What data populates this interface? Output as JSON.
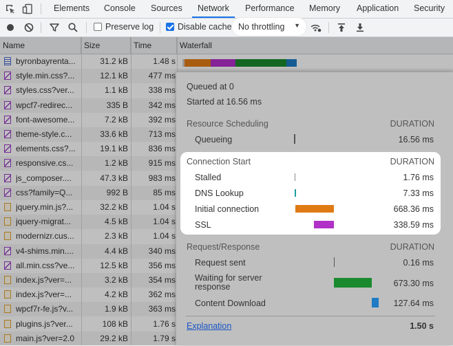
{
  "tabs": {
    "items": [
      "Elements",
      "Console",
      "Sources",
      "Network",
      "Performance",
      "Memory",
      "Application",
      "Security"
    ],
    "active": "Network"
  },
  "toolbar": {
    "preserve_log": "Preserve log",
    "preserve_log_checked": false,
    "disable_cache": "Disable cache",
    "disable_cache_checked": true,
    "throttling": "No throttling"
  },
  "columns": [
    "Name",
    "Size",
    "Time",
    "Waterfall"
  ],
  "rows": [
    {
      "name": "byronbayrenta...",
      "size": "31.2 kB",
      "time": "1.48 s",
      "type": "doc"
    },
    {
      "name": "style.min.css?...",
      "size": "12.1 kB",
      "time": "477 ms",
      "type": "css"
    },
    {
      "name": "styles.css?ver...",
      "size": "1.1 kB",
      "time": "338 ms",
      "type": "css"
    },
    {
      "name": "wpcf7-redirec...",
      "size": "335 B",
      "time": "342 ms",
      "type": "css"
    },
    {
      "name": "font-awesome...",
      "size": "7.2 kB",
      "time": "392 ms",
      "type": "css"
    },
    {
      "name": "theme-style.c...",
      "size": "33.6 kB",
      "time": "713 ms",
      "type": "css"
    },
    {
      "name": "elements.css?...",
      "size": "19.1 kB",
      "time": "836 ms",
      "type": "css"
    },
    {
      "name": "responsive.cs...",
      "size": "1.2 kB",
      "time": "915 ms",
      "type": "css"
    },
    {
      "name": "js_composer....",
      "size": "47.3 kB",
      "time": "983 ms",
      "type": "css"
    },
    {
      "name": "css?family=Q...",
      "size": "992 B",
      "time": "85 ms",
      "type": "css"
    },
    {
      "name": "jquery.min.js?...",
      "size": "32.2 kB",
      "time": "1.04 s",
      "type": "js"
    },
    {
      "name": "jquery-migrat...",
      "size": "4.5 kB",
      "time": "1.04 s",
      "type": "js"
    },
    {
      "name": "modernizr.cus...",
      "size": "2.3 kB",
      "time": "1.04 s",
      "type": "js"
    },
    {
      "name": "v4-shims.min....",
      "size": "4.4 kB",
      "time": "340 ms",
      "type": "css"
    },
    {
      "name": "all.min.css?ve...",
      "size": "12.5 kB",
      "time": "356 ms",
      "type": "css"
    },
    {
      "name": "index.js?ver=...",
      "size": "3.2 kB",
      "time": "354 ms",
      "type": "js"
    },
    {
      "name": "index.js?ver=...",
      "size": "4.2 kB",
      "time": "362 ms",
      "type": "js"
    },
    {
      "name": "wpcf7r-fe.js?v...",
      "size": "1.9 kB",
      "time": "363 ms",
      "type": "js"
    },
    {
      "name": "plugins.js?ver...",
      "size": "108 kB",
      "time": "1.76 s",
      "type": "js"
    },
    {
      "name": "main.js?ver=2.0",
      "size": "29.2 kB",
      "time": "1.79 s",
      "type": "js"
    }
  ],
  "timing": {
    "queued_at": "Queued at 0",
    "started_at": "Started at 16.56 ms",
    "duration_label": "DURATION",
    "sections": [
      {
        "title": "Resource Scheduling",
        "items": [
          {
            "label": "Queueing",
            "value": "16.56 ms",
            "color": "#555555"
          }
        ]
      },
      {
        "title": "Connection Start",
        "items": [
          {
            "label": "Stalled",
            "value": "1.76 ms",
            "color": "#888888"
          },
          {
            "label": "DNS Lookup",
            "value": "7.33 ms",
            "color": "#1a9e9e"
          },
          {
            "label": "Initial connection",
            "value": "668.36 ms",
            "color": "#e07b14"
          },
          {
            "label": "SSL",
            "value": "338.59 ms",
            "color": "#b130c8"
          }
        ]
      },
      {
        "title": "Request/Response",
        "items": [
          {
            "label": "Request sent",
            "value": "0.16 ms",
            "color": "#555555"
          },
          {
            "label": "Waiting for server response",
            "value": "673.30 ms",
            "color": "#1a8a2e"
          },
          {
            "label": "Content Download",
            "value": "127.64 ms",
            "color": "#1e7bc4"
          }
        ]
      }
    ],
    "explanation": "Explanation",
    "total": "1.50 s"
  },
  "colors": {
    "accent": "#1a73e8",
    "css_icon": "#9b3dc7",
    "js_icon": "#e2a12d",
    "doc_icon": "#4f6fd1"
  }
}
